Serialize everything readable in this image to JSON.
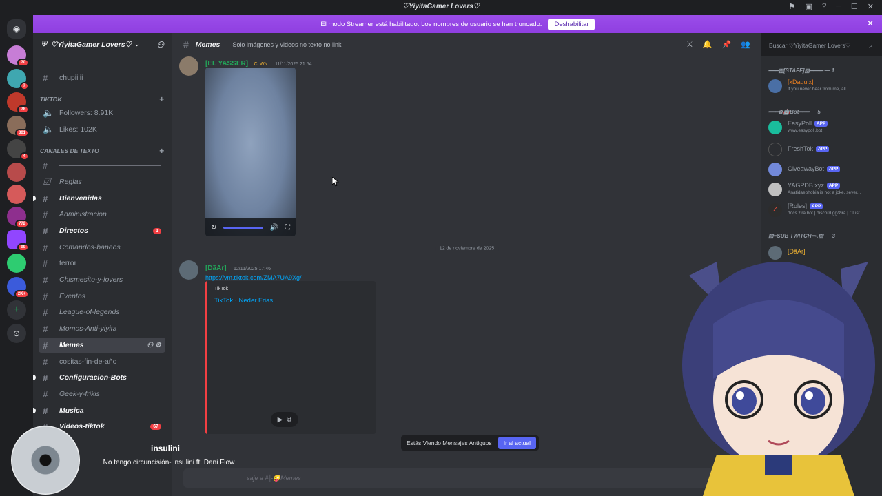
{
  "window": {
    "title": "♡YiyitaGamer Lovers♡"
  },
  "banner": {
    "text": "El modo Streamer está habilitado. Los nombres de usuario se han truncado.",
    "button": "Deshabilitar"
  },
  "servers": {
    "badges": [
      "70",
      "7",
      "78",
      "301",
      "4",
      "772",
      "99",
      "2K+"
    ]
  },
  "guild": {
    "name": "♡YiyitaGamer Lovers♡"
  },
  "sidebar": {
    "top_channel": "chupiiiii",
    "tiktok_category": "TIKTOK",
    "tiktok_stats": [
      "Followers: 8.91K",
      "Likes: 102K"
    ],
    "text_category": "CANALES DE TEXTO",
    "channels": [
      {
        "label": "Reglas"
      },
      {
        "label": "Bienvenidas"
      },
      {
        "label": "Administracion"
      },
      {
        "label": "Directos",
        "unread": "1"
      },
      {
        "label": "Comandos-baneos"
      },
      {
        "label": "terror"
      },
      {
        "label": "Chismesito-y-lovers"
      },
      {
        "label": "Eventos"
      },
      {
        "label": "League-of-legends"
      },
      {
        "label": "Momos-Anti-yiyita"
      },
      {
        "label": "Memes"
      },
      {
        "label": "cositas-fin-de-año"
      },
      {
        "label": "Configuracion-Bots"
      },
      {
        "label": "Geek-y-frikis"
      },
      {
        "label": "Musica"
      },
      {
        "label": "Videos-tiktok",
        "unread": "67"
      }
    ]
  },
  "channel": {
    "name": "Memes",
    "topic": "Solo imágenes y videos no texto no link",
    "search_placeholder": "Buscar ♡YiyitaGamer Lovers♡"
  },
  "messages": [
    {
      "author": "[EL YASSER]",
      "tag": "CLWN",
      "timestamp": "11/11/2025 21:54"
    },
    {
      "author": "[DãAr]",
      "timestamp": "12/11/2025 17:46",
      "link": "https://vm.tiktok.com/ZMA7UA9Xg/",
      "embed_provider": "TikTok",
      "embed_title": "TikTok · Neder Frias"
    }
  ],
  "date_divider": "12 de noviembre de 2025",
  "jump_bar": {
    "text": "Estás Viendo Mensajes Antiguos",
    "button": "Ir al actual"
  },
  "composer": {
    "placeholder": "saje a #╟😜Memes"
  },
  "members": {
    "groups": [
      {
        "title": "━━━▧[STAFF]▧━━━━ — 1"
      },
      {
        "title": "━━━✿🤖Bot━━━ — 5"
      },
      {
        "title": "▧━SUB TWITCH━◦.▧ — 3"
      }
    ],
    "list": [
      {
        "name": "[xDaguix]",
        "status": "If you never hear from me, all...",
        "color": "#e67e22"
      },
      {
        "name": "EasyPoll",
        "status": "www.easypoll.bot",
        "app": "APP"
      },
      {
        "name": "FreshTok",
        "status": "",
        "app": "APP"
      },
      {
        "name": "GiveawayBot",
        "status": "",
        "app": "APP"
      },
      {
        "name": "YAGPDB.xyz",
        "status": "Anatidaephobia is not a joke, sever...",
        "app": "APP"
      },
      {
        "name": "[Roles]",
        "status": "docs.zira.bot | discord.gg/zira | Clust",
        "app": "APP"
      },
      {
        "name": "[DãAr]",
        "status": "",
        "color": "#f0b232"
      }
    ]
  },
  "now_playing": {
    "track": "insulini",
    "artist": "No tengo circuncisión- insulini ft. Dani Flow"
  }
}
